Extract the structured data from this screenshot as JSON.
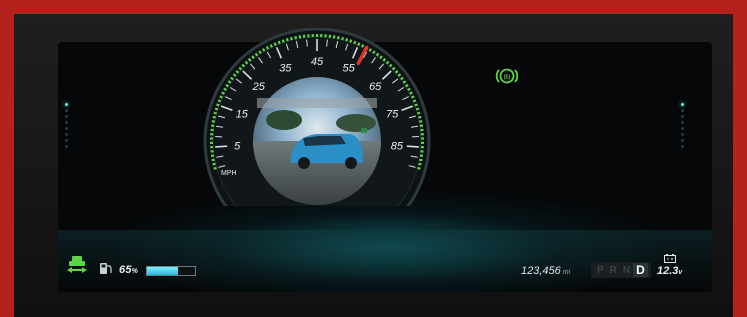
{
  "speedometer": {
    "ticks": [
      "5",
      "15",
      "25",
      "35",
      "45",
      "55",
      "65",
      "75",
      "85"
    ],
    "unit": "MPH",
    "speed_value": 57
  },
  "indicators": {
    "turn_signal_icon": "left-arrow-icon",
    "brake_icon": "parking-brake-icon"
  },
  "status": {
    "fuel_percent_number": "65",
    "fuel_percent_symbol": "%",
    "fuel_level": 0.65,
    "odometer_value": "123,456",
    "odometer_unit": "mi",
    "gears": [
      "P",
      "R",
      "N",
      "D"
    ],
    "selected_gear": "D",
    "battery_voltage_number": "12.3",
    "battery_voltage_unit": "v"
  },
  "colors": {
    "accent_green": "#5fd34a",
    "needle_red": "#e3342a",
    "glow_cyan": "#2bc6d8",
    "frame_red": "#b3231b"
  }
}
